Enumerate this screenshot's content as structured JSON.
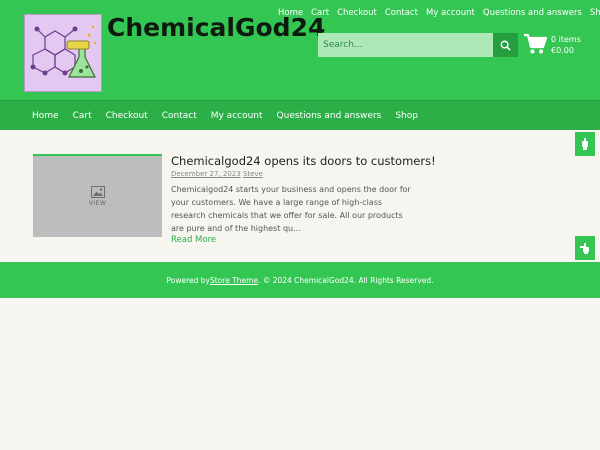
{
  "site": {
    "title": "ChemicalGod24"
  },
  "top_nav": [
    {
      "label": "Home"
    },
    {
      "label": "Cart"
    },
    {
      "label": "Checkout"
    },
    {
      "label": "Contact"
    },
    {
      "label": "My account"
    },
    {
      "label": "Questions and answers"
    },
    {
      "label": "Shop"
    }
  ],
  "search": {
    "placeholder": "Search..."
  },
  "cart": {
    "items": "0 items",
    "total": "€0.00"
  },
  "main_nav": [
    {
      "label": "Home"
    },
    {
      "label": "Cart"
    },
    {
      "label": "Checkout"
    },
    {
      "label": "Contact"
    },
    {
      "label": "My account"
    },
    {
      "label": "Questions and answers"
    },
    {
      "label": "Shop"
    }
  ],
  "post": {
    "thumb_label": "VIEW",
    "title": "Chemicalgod24 opens its doors to customers!",
    "date": "December 27, 2023",
    "author": "Steve",
    "excerpt": "Chemicalgod24 starts your business and opens the door for your customers. We have a large range of high-class research chemicals that we offer for sale. All our products are pure and of the highest qu...",
    "read_more": "Read More"
  },
  "footer": {
    "prefix": "Powered by ",
    "theme": "Store Theme",
    "suffix": ". © 2024 ChemicalGod24. All Rights Reserved."
  },
  "colors": {
    "green": "#33c653",
    "nav_green": "#2daf48",
    "background": "#f7f5ef"
  }
}
